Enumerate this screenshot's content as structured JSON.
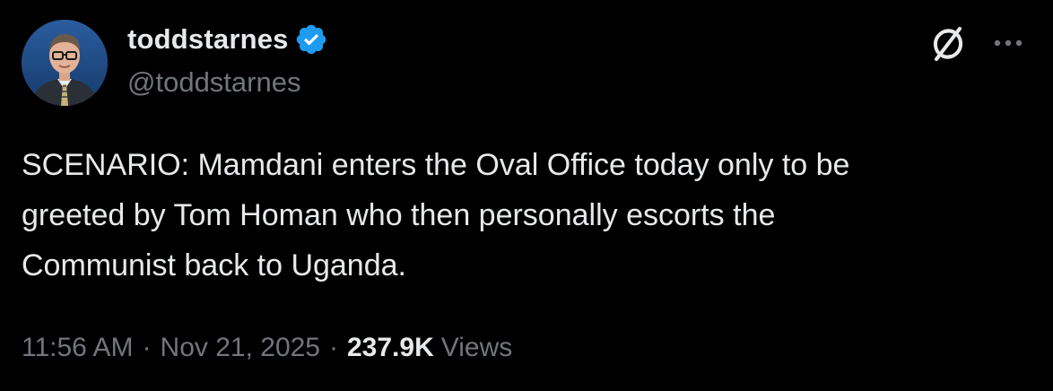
{
  "author": {
    "display_name": "toddstarnes",
    "handle": "@toddstarnes",
    "verified": true,
    "badge_color": "#1d9bf0"
  },
  "icons": {
    "grok": "grok-icon",
    "more": "more-icon",
    "verified": "verified-badge-icon"
  },
  "tweet": {
    "text_lines": [
      "SCENARIO: Mamdani enters the Oval Office today only to be",
      "greeted by Tom Homan who then personally escorts the",
      "Communist back to Uganda."
    ]
  },
  "meta": {
    "time": "11:56 AM",
    "separator": "·",
    "date": "Nov 21, 2025",
    "views_count": "237.9K",
    "views_label": "Views"
  },
  "colors": {
    "background": "#000000",
    "text_primary": "#e7e9ea",
    "text_secondary": "#71767b",
    "accent": "#1d9bf0"
  }
}
